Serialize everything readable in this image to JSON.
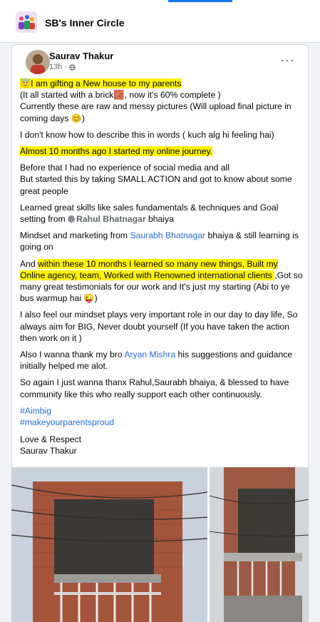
{
  "group": {
    "name": "SB's Inner Circle"
  },
  "post": {
    "author": "Saurav Thakur",
    "time": "13h",
    "privacy_sep": "·",
    "more_icon": "more-horizontal-icon",
    "paragraphs": {
      "p1_hl": "😇I am gifting a New house to my parents",
      "p1_rest": "(It all started with a brick🧱, now it's 60% complete )\nCurrently these are raw and messy pictures (Will upload final picture in coming days 😊)",
      "p2": "I don't know how to describe this in words ( kuch alg hi feeling hai)",
      "p3_hl": "Almost 10 months ago I started my online journey.",
      "p4": "Before that I had no experience of social media and all\nBut started this by taking SMALL ACTION and got to know about some great people",
      "p5_pre": "Learned great skills like sales fundamentals & techniques and Goal setting from ",
      "p5_mention": "Rahul Bhatnagar",
      "p5_post": "  bhaiya",
      "p6_pre": "Mindset and marketing from ",
      "p6_link": "Saurabh Bhatnagar",
      "p6_post": "  bhaiya & still learning is going on",
      "p7_pre": "And ",
      "p7_hl": "within these 10 months I learned so many new things, Built my Online agency, team, Worked with Renowned international clients ",
      "p7_post": ",Got so many great testimonials for our work and It's just my starting (Abi to ye bus warmup hai 😜)",
      "p8": "I also feel our mindset plays very important role in our day to day life, So always aim for BIG, Never doubt yourself (If you have taken the action then work on it )",
      "p9_pre": "Also I wanna thank my bro ",
      "p9_link": "Aryan Mishra",
      "p9_post": "  his suggestions and guidance initially helped me alot.",
      "p10": "So again I just wanna thanx Rahul,Saurabh bhaiya, & blessed to have community like this who really support each other continuously.",
      "tag1": "#Aimbig",
      "tag2": "#makeyourparentsproud",
      "sign_off": "Love & Respect",
      "signature": "Saurav Thakur"
    }
  },
  "colors": {
    "accent": "#1877f2",
    "link": "#216fdb",
    "highlight": "#fff200",
    "meta": "#65676b"
  }
}
